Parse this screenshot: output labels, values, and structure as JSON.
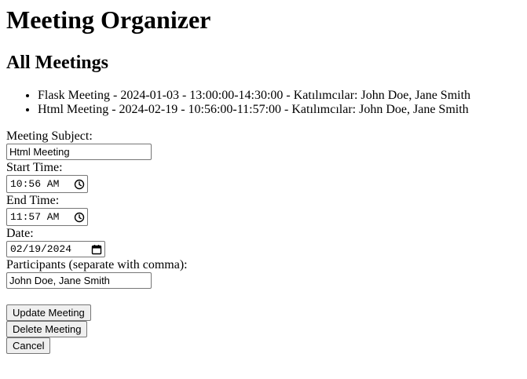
{
  "page": {
    "title": "Meeting Organizer",
    "section_title": "All Meetings"
  },
  "meetings": [
    {
      "text": "Flask Meeting - 2024-01-03 - 13:00:00-14:30:00 - Katılımcılar: John Doe, Jane Smith"
    },
    {
      "text": "Html Meeting - 2024-02-19 - 10:56:00-11:57:00 - Katılımcılar: John Doe, Jane Smith"
    }
  ],
  "form": {
    "subject_label": "Meeting Subject:",
    "subject_value": "Html Meeting",
    "start_label": "Start Time:",
    "start_value": "10:56 AM",
    "end_label": "End Time:",
    "end_value": "11:57 AM",
    "date_label": "Date:",
    "date_value": "02/19/2024",
    "participants_label": "Participants (separate with comma):",
    "participants_value": "John Doe, Jane Smith"
  },
  "buttons": {
    "update": "Update Meeting",
    "delete": "Delete Meeting",
    "cancel": "Cancel"
  },
  "icons": {
    "time": "clock-icon",
    "date": "calendar-icon"
  }
}
